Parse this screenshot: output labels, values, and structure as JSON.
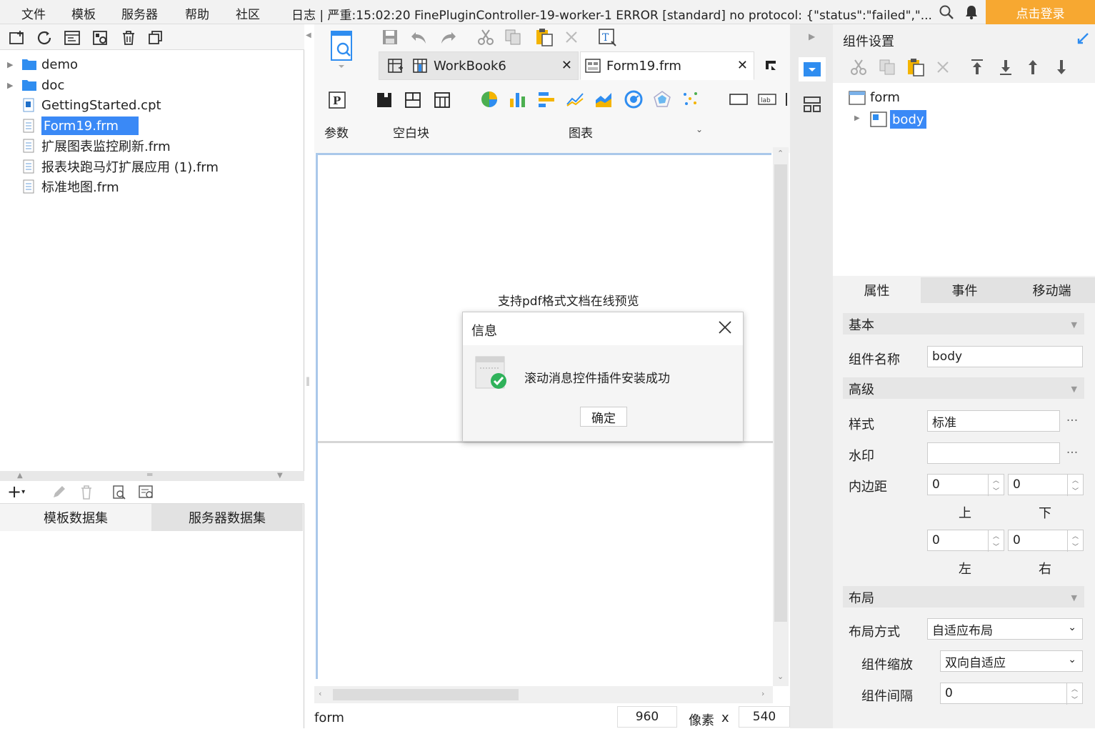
{
  "menubar": {
    "items": [
      "文件",
      "模板",
      "服务器",
      "帮助",
      "社区"
    ],
    "log_message": "日志 | 严重:15:02:20 FinePluginController-19-worker-1 ERROR [standard] no protocol: {\"status\":\"failed\",\"...",
    "login_label": "点击登录"
  },
  "file_tree": {
    "items": [
      {
        "label": "demo",
        "type": "folder"
      },
      {
        "label": "doc",
        "type": "folder"
      },
      {
        "label": "GettingStarted.cpt",
        "type": "cpt"
      },
      {
        "label": "Form19.frm",
        "type": "frm",
        "selected": true
      },
      {
        "label": "扩展图表监控刷新.frm",
        "type": "frm"
      },
      {
        "label": "报表块跑马灯扩展应用 (1).frm",
        "type": "frm"
      },
      {
        "label": "标准地图.frm",
        "type": "frm"
      }
    ]
  },
  "datasets": {
    "tabs": [
      "模板数据集",
      "服务器数据集"
    ]
  },
  "editor": {
    "tabs": [
      {
        "label": "WorkBook6"
      },
      {
        "label": "Form19.frm",
        "active": true
      }
    ],
    "ribbon_labels": {
      "param": "参数",
      "blank": "空白块",
      "chart": "图表"
    },
    "canvas_text": "支持pdf格式文档在线预览",
    "status": {
      "form_label": "form",
      "width": "960",
      "unit": "像素",
      "x": "x",
      "height": "540"
    }
  },
  "dialog": {
    "title": "信息",
    "message": "滚动消息控件插件安装成功",
    "ok_label": "确定"
  },
  "right_panel": {
    "title": "组件设置",
    "tree": {
      "root": "form",
      "child": "body"
    },
    "tabs": [
      "属性",
      "事件",
      "移动端"
    ],
    "sections": {
      "basic": "基本",
      "advanced": "高级",
      "layout": "布局"
    },
    "fields": {
      "component_name_label": "组件名称",
      "component_name_value": "body",
      "style_label": "样式",
      "style_value": "标准",
      "watermark_label": "水印",
      "watermark_value": "",
      "padding_label": "内边距",
      "padding_top": "0",
      "padding_bottom": "0",
      "padding_left": "0",
      "padding_right": "0",
      "top_label": "上",
      "bottom_label": "下",
      "left_label": "左",
      "right_label": "右",
      "layout_mode_label": "布局方式",
      "layout_mode_value": "自适应布局",
      "scale_label": "组件缩放",
      "scale_value": "双向自适应",
      "gap_label": "组件间隔",
      "gap_value": "0"
    }
  },
  "colors": {
    "accent": "#3a89f6",
    "login": "#f7a831"
  }
}
